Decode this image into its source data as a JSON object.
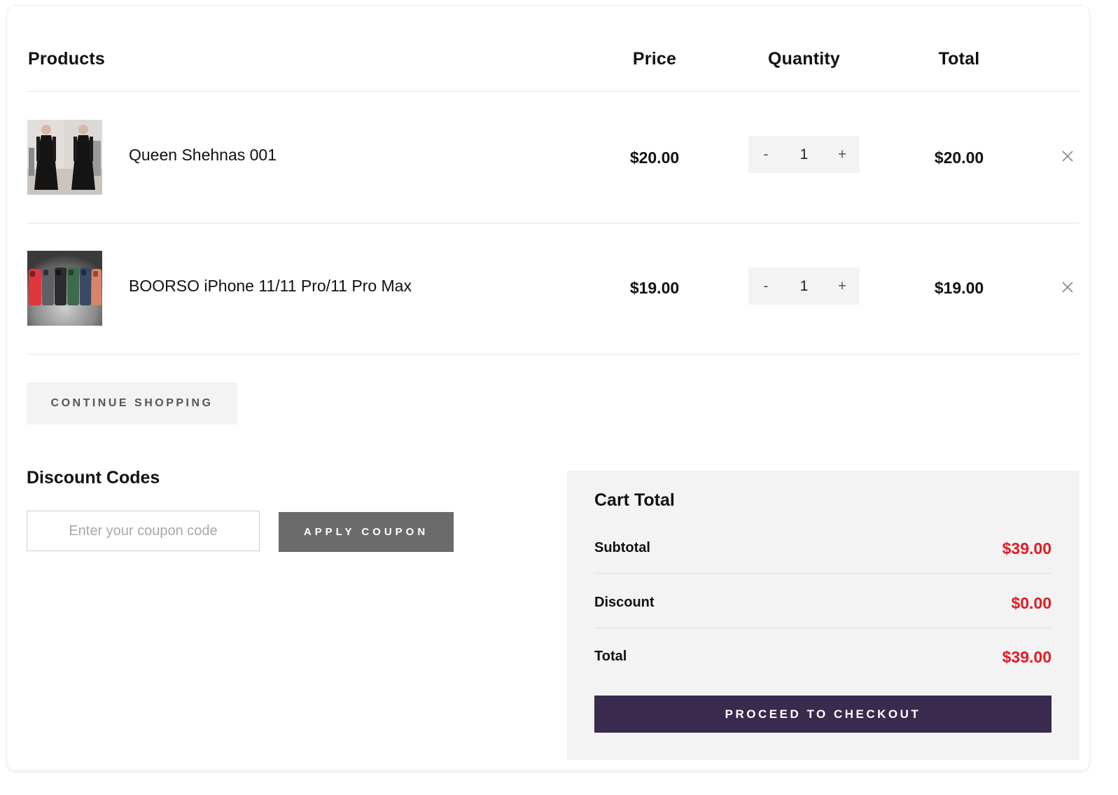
{
  "table": {
    "headers": {
      "products": "Products",
      "price": "Price",
      "quantity": "Quantity",
      "total": "Total"
    },
    "rows": [
      {
        "name": "Queen Shehnas 001",
        "price": "$20.00",
        "quantity": "1",
        "total": "$20.00",
        "minus": "-",
        "plus": "+",
        "image": "black-abaya-product-photo"
      },
      {
        "name": "BOORSO iPhone 11/11 Pro/11 Pro Max",
        "price": "$19.00",
        "quantity": "1",
        "total": "$19.00",
        "minus": "-",
        "plus": "+",
        "image": "phone-cases-product-photo"
      }
    ]
  },
  "continue_label": "CONTINUE SHOPPING",
  "discount": {
    "title": "Discount Codes",
    "placeholder": "Enter your coupon code",
    "value": "",
    "apply_label": "APPLY COUPON"
  },
  "cart_total": {
    "title": "Cart Total",
    "subtotal_label": "Subtotal",
    "subtotal_value": "$39.00",
    "discount_label": "Discount",
    "discount_value": "$0.00",
    "total_label": "Total",
    "total_value": "$39.00",
    "checkout_label": "PROCEED TO CHECKOUT"
  },
  "colors": {
    "accent_red": "#e31b23",
    "checkout_bg": "#3a2a4e",
    "apply_bg": "#6b6b6b",
    "panel_bg": "#f3f3f3"
  }
}
